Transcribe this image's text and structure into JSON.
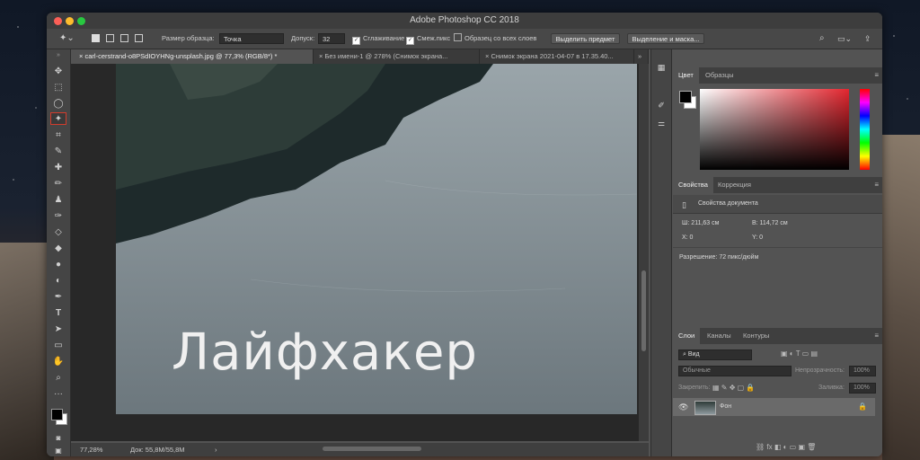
{
  "window": {
    "title": "Adobe Photoshop CC 2018"
  },
  "options": {
    "sample_size_label": "Размер образца:",
    "sample_size_value": "Точка",
    "tolerance_label": "Допуск:",
    "tolerance_value": "32",
    "antialias_label": "Сглаживание",
    "contiguous_label": "Смеж.пикс",
    "all_layers_label": "Образец со всех слоев",
    "select_subject_label": "Выделить предмет",
    "select_mask_label": "Выделение и маска..."
  },
  "tabs": [
    {
      "label": "carl-cerstrand-o8PSdIOYHNg-unsplash.jpg @ 77,3% (RGB/8*) *",
      "close": "×"
    },
    {
      "label": "Без имени-1 @ 278% (Снимок экрана...",
      "close": "×"
    },
    {
      "label": "Снимок экрана 2021-04-07 в 17.35.40...",
      "close": "×"
    }
  ],
  "canvas": {
    "overlay_text": "Лайфхакер"
  },
  "status": {
    "zoom": "77,28%",
    "doc": "Док: 55,8M/55,8M",
    "arrow": "›"
  },
  "color_panel": {
    "tab_color": "Цвет",
    "tab_swatches": "Образцы"
  },
  "properties_panel": {
    "tab_properties": "Свойства",
    "tab_adjustments": "Коррекция",
    "doc_props": "Свойства документа",
    "width": "Ш: 211,63 см",
    "height": "В: 114,72 см",
    "x": "X: 0",
    "y": "Y: 0",
    "resolution": "Разрешение: 72 пикс/дюйм"
  },
  "layers_panel": {
    "tab_layers": "Слои",
    "tab_channels": "Каналы",
    "tab_paths": "Контуры",
    "filter_placeholder": "Вид",
    "blend_mode": "Обычные",
    "opacity_label": "Непрозрачность:",
    "opacity_value": "100%",
    "lock_label": "Закрепить:",
    "fill_label": "Заливка:",
    "fill_value": "100%",
    "layer_name": "Фон"
  },
  "colors": {
    "accent": "#d23c2c",
    "fg": "#000000",
    "bg": "#ffffff"
  }
}
